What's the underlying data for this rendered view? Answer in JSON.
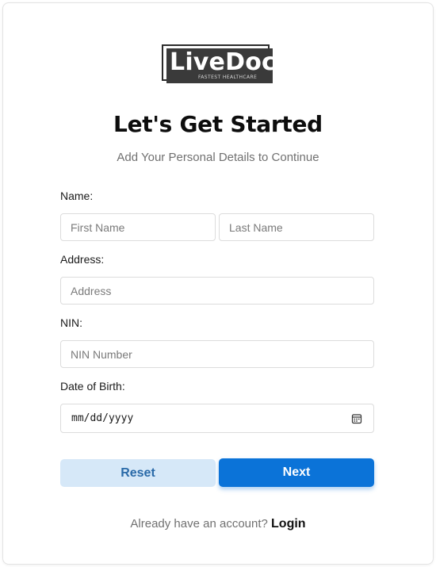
{
  "logo": {
    "brand": "LiveDoc",
    "tagline": "FASTEST HEALTHCARE"
  },
  "header": {
    "title": "Let's Get Started",
    "subtitle": "Add Your Personal Details to Continue"
  },
  "form": {
    "name_label": "Name:",
    "first_name_placeholder": "First Name",
    "last_name_placeholder": "Last Name",
    "address_label": "Address:",
    "address_placeholder": "Address",
    "nin_label": "NIN:",
    "nin_placeholder": "NIN Number",
    "dob_label": "Date of Birth:",
    "dob_placeholder": "mm/dd/yyyy"
  },
  "actions": {
    "reset_label": "Reset",
    "next_label": "Next"
  },
  "footer": {
    "prompt": "Already have an account?",
    "login_label": "Login"
  },
  "colors": {
    "primary": "#0b73d8",
    "secondary_bg": "#d6e8f8",
    "secondary_text": "#2a6aa8"
  }
}
